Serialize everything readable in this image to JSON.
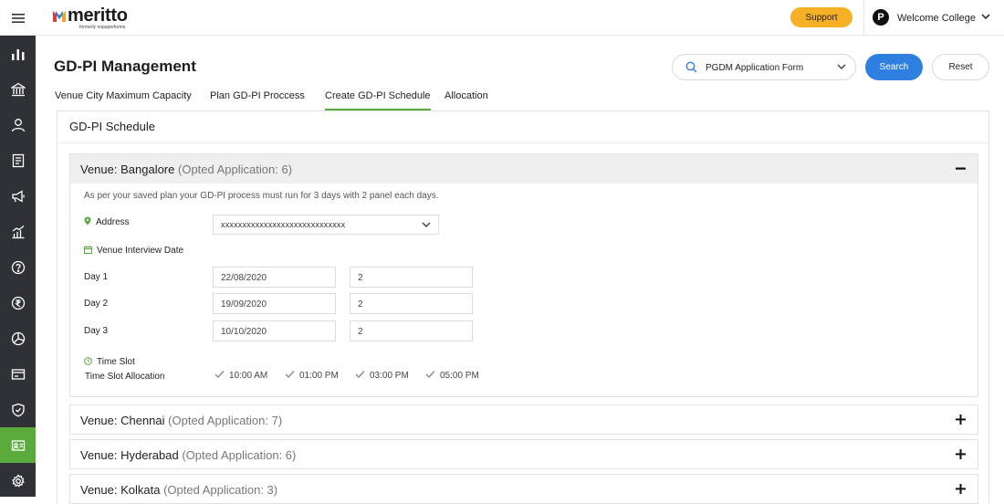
{
  "brand": {
    "name": "meritto",
    "tagline": "formerly nopaperforms"
  },
  "header": {
    "support_label": "Support",
    "college_initial": "P",
    "college_name": "Welcome College"
  },
  "sidebar": {
    "items": [
      {
        "icon": "bar-chart-icon"
      },
      {
        "icon": "bank-icon"
      },
      {
        "icon": "user-icon"
      },
      {
        "icon": "list-icon"
      },
      {
        "icon": "megaphone-icon"
      },
      {
        "icon": "analytics-icon"
      },
      {
        "icon": "help-icon"
      },
      {
        "icon": "rupee-icon"
      },
      {
        "icon": "pie-chart-icon"
      },
      {
        "icon": "card-icon"
      },
      {
        "icon": "shield-icon"
      },
      {
        "icon": "id-card-icon",
        "active": true
      },
      {
        "icon": "settings-icon"
      }
    ]
  },
  "page": {
    "title": "GD-PI Management",
    "form_select": "PGDM Application Form",
    "search_label": "Search",
    "reset_label": "Reset"
  },
  "tabs": [
    {
      "label": "Venue City Maximum Capacity",
      "active": false
    },
    {
      "label": "Plan GD-PI Proccess",
      "active": false
    },
    {
      "label": "Create GD-PI Schedule",
      "active": true
    },
    {
      "label": "Allocation",
      "active": false
    }
  ],
  "schedule": {
    "title": "GD-PI Schedule",
    "venues": [
      {
        "name": "Venue: Bangalore",
        "opted": "(Opted Application: 6)",
        "expanded": true,
        "note": "As per your saved plan your GD-PI process must run for 3 days with 2 panel each days.",
        "address_label": "Address",
        "address_value": "xxxxxxxxxxxxxxxxxxxxxxxxxxxxx",
        "interview_date_label": "Venue Interview Date",
        "days": [
          {
            "label": "Day 1",
            "date": "22/08/2020",
            "panels": "2"
          },
          {
            "label": "Day 2",
            "date": "19/09/2020",
            "panels": "2"
          },
          {
            "label": "Day 3",
            "date": "10/10/2020",
            "panels": "2"
          }
        ],
        "time_slot_label": "Time Slot",
        "time_slot_allocation_label": "Time Slot Allocation",
        "slots": [
          "10:00 AM",
          "01:00 PM",
          "03:00 PM",
          "05:00 PM"
        ]
      },
      {
        "name": "Venue: Chennai",
        "opted": "(Opted Application: 7)",
        "expanded": false
      },
      {
        "name": "Venue: Hyderabad",
        "opted": "(Opted Application: 6)",
        "expanded": false
      },
      {
        "name": "Venue: Kolkata",
        "opted": "(Opted Application: 3)",
        "expanded": false
      }
    ]
  },
  "colors": {
    "accent_green": "#5aab3c",
    "primary_blue": "#2f7fe0",
    "support_yellow": "#f5b025",
    "sidebar_bg": "#2f3136"
  }
}
